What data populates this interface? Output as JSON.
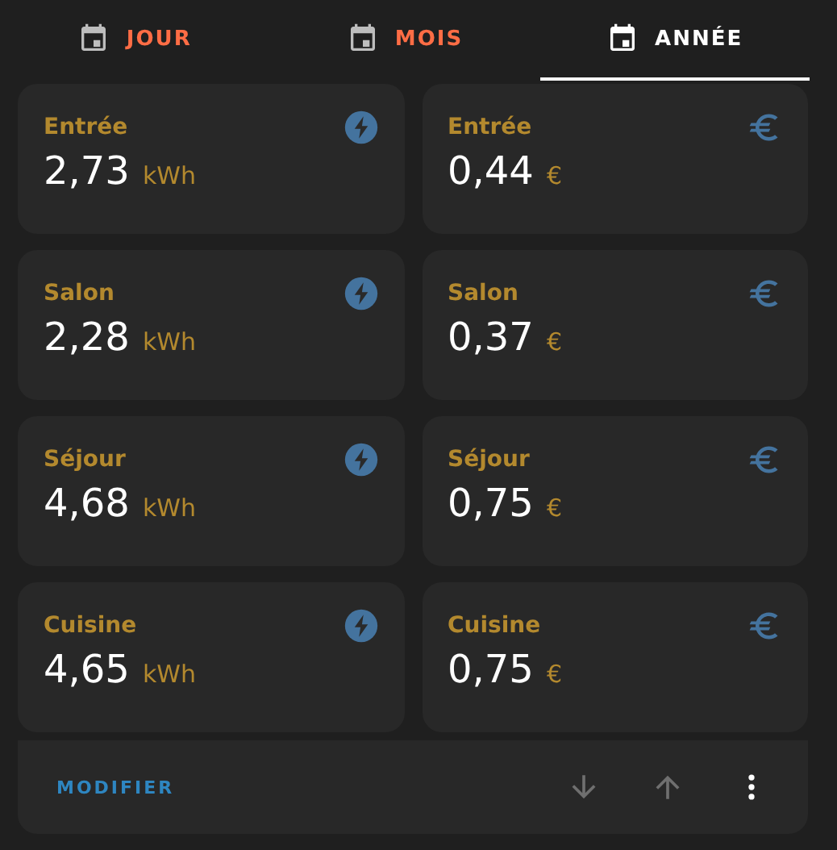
{
  "tabs": [
    {
      "label": "JOUR",
      "selected": false
    },
    {
      "label": "MOIS",
      "selected": false
    },
    {
      "label": "ANNÉE",
      "selected": true
    }
  ],
  "cards": [
    {
      "kind": "energy",
      "name": "Entrée",
      "value": "2,73",
      "unit": "kWh"
    },
    {
      "kind": "cost",
      "name": "Entrée",
      "value": "0,44",
      "unit": "€"
    },
    {
      "kind": "energy",
      "name": "Salon",
      "value": "2,28",
      "unit": "kWh"
    },
    {
      "kind": "cost",
      "name": "Salon",
      "value": "0,37",
      "unit": "€"
    },
    {
      "kind": "energy",
      "name": "Séjour",
      "value": "4,68",
      "unit": "kWh"
    },
    {
      "kind": "cost",
      "name": "Séjour",
      "value": "0,75",
      "unit": "€"
    },
    {
      "kind": "energy",
      "name": "Cuisine",
      "value": "4,65",
      "unit": "kWh"
    },
    {
      "kind": "cost",
      "name": "Cuisine",
      "value": "0,75",
      "unit": "€"
    }
  ],
  "footer": {
    "edit_label": "MODIFIER"
  }
}
